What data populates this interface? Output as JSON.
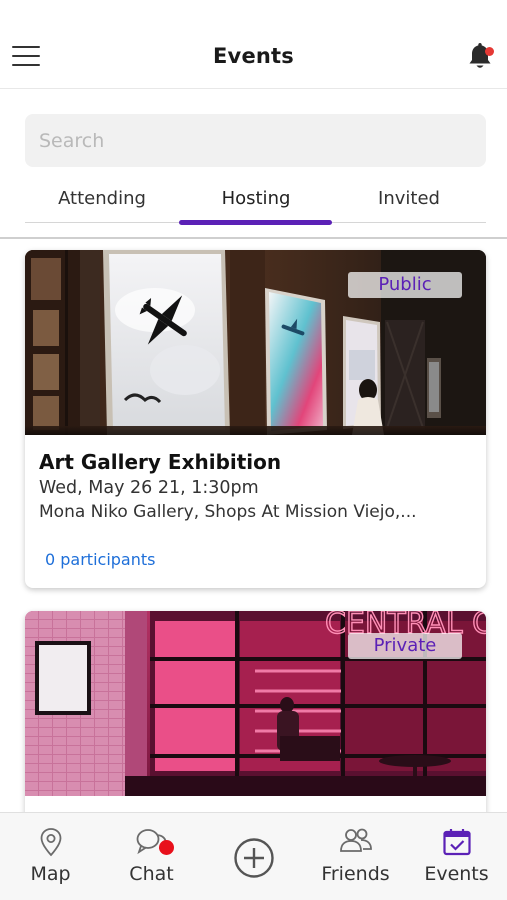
{
  "header": {
    "title": "Events",
    "menu_icon": "hamburger-menu-icon",
    "notification_icon": "bell-icon"
  },
  "search": {
    "placeholder": "Search",
    "value": ""
  },
  "tabs": [
    {
      "label": "Attending",
      "active": false
    },
    {
      "label": "Hosting",
      "active": true
    },
    {
      "label": "Invited",
      "active": false
    }
  ],
  "events": [
    {
      "visibility": "Public",
      "title": "Art Gallery Exhibition",
      "date": "Wed, May 26 21, 1:30pm",
      "location": "Mona Niko Gallery, Shops At Mission Viejo,...",
      "participants": "0 participants"
    },
    {
      "visibility": "Private",
      "sign_text": "CENTRAL CINEMA"
    }
  ],
  "bottom_nav": [
    {
      "label": "Map",
      "icon": "map-pin-icon"
    },
    {
      "label": "Chat",
      "icon": "chat-bubbles-icon"
    },
    {
      "label": "",
      "icon": "add-circle-icon"
    },
    {
      "label": "Friends",
      "icon": "friends-icon"
    },
    {
      "label": "Events",
      "icon": "calendar-check-icon",
      "active": true
    }
  ],
  "colors": {
    "accent": "#5b21b6",
    "link": "#1e6fd9",
    "notification": "#e53935"
  }
}
